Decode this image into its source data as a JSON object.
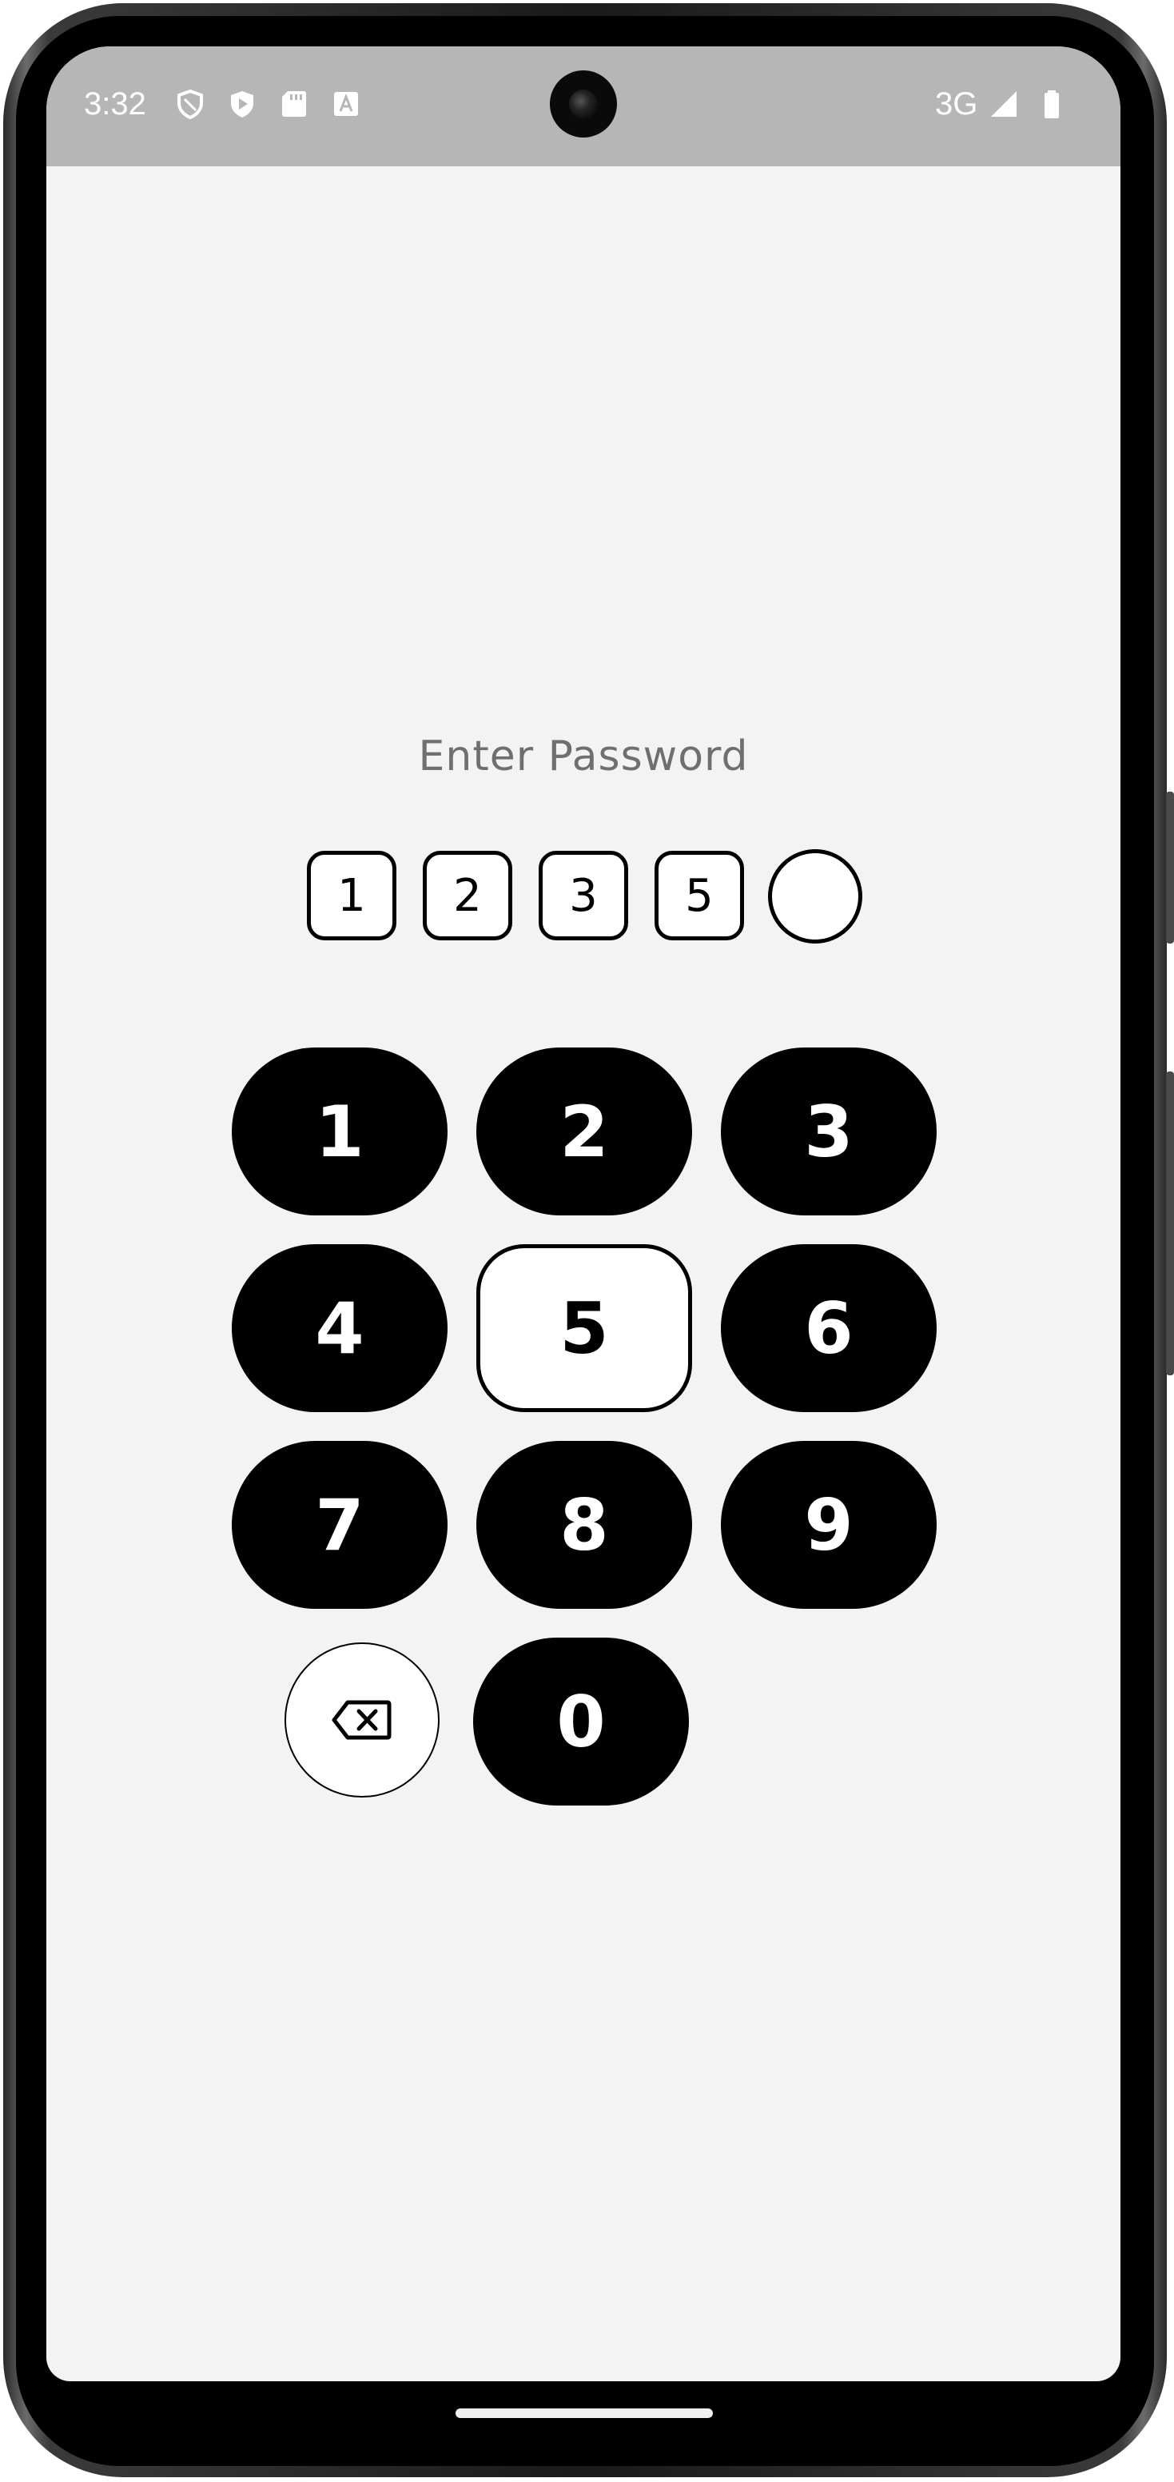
{
  "status_bar": {
    "time": "3:32",
    "icons": [
      "shield-outline-icon",
      "shield-play-icon",
      "sd-card-icon",
      "keyboard-a-icon"
    ],
    "network": "3G",
    "right_icons": [
      "signal-icon",
      "battery-icon"
    ]
  },
  "screen": {
    "title": "Enter Password",
    "pin_digits": [
      "1",
      "2",
      "3",
      "5",
      ""
    ]
  },
  "keypad": {
    "keys": [
      "1",
      "2",
      "3",
      "4",
      "5",
      "6",
      "7",
      "8",
      "9",
      "0"
    ],
    "active_key": "5",
    "backspace_icon": "backspace-icon"
  },
  "colors": {
    "background": "#f3f3f3",
    "status_bar": "#b6b6b6",
    "key": "#000000",
    "key_text": "#ffffff",
    "title": "#6f6f6f"
  }
}
